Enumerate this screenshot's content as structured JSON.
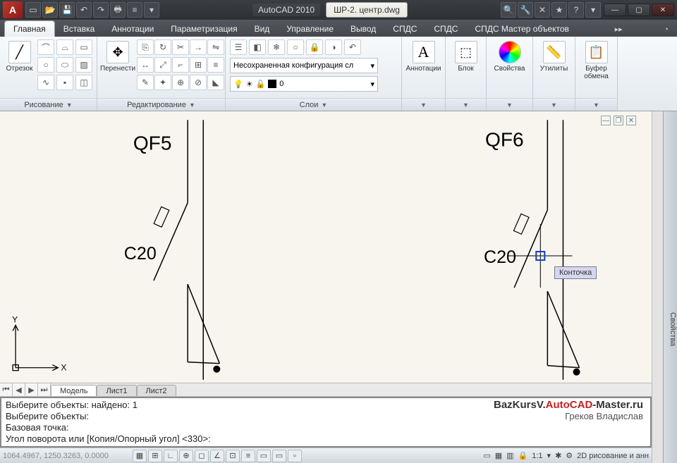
{
  "titlebar": {
    "app": "AutoCAD 2010",
    "doc": "ШР-2. центр.dwg"
  },
  "tabs": [
    "Главная",
    "Вставка",
    "Аннотации",
    "Параметризация",
    "Вид",
    "Управление",
    "Вывод",
    "СПДС",
    "СПДС",
    "СПДС Мастер объектов"
  ],
  "tabs_overflow": "▸▸",
  "panels": {
    "draw": {
      "title": "Рисование",
      "big": "Отрезок"
    },
    "edit": {
      "title": "Редактирование",
      "big": "Перенести"
    },
    "layers": {
      "title": "Слои",
      "combo": "Несохраненная конфигурация сл",
      "current": "0"
    },
    "anno": {
      "title": "",
      "big": "Аннотации"
    },
    "block": {
      "title": "",
      "big": "Блок"
    },
    "props": {
      "title": "",
      "big": "Свойства"
    },
    "util": {
      "title": "",
      "big": "Утилиты"
    },
    "clip": {
      "title": "",
      "big": "Буфер обмена"
    }
  },
  "drawing": {
    "labels": {
      "qf5": "QF5",
      "qf6": "QF6",
      "c20a": "C20",
      "c20b": "C20"
    },
    "tooltip": "Конточка",
    "axis_x": "X",
    "axis_y": "Y"
  },
  "sheets": {
    "model": "Модель",
    "s1": "Лист1",
    "s2": "Лист2"
  },
  "cmd": {
    "l1": "Выберите объекты: найдено: 1",
    "l2": "Выберите объекты:",
    "l3": "Базовая точка:",
    "l4": "Угол поворота или [Копия/Опорный угол] <330>:"
  },
  "watermark": {
    "prefix": "BazKursV.",
    "acad": "AutoCAD",
    "suffix": "-Master.ru",
    "author": "Греков Владислав"
  },
  "status": {
    "coords": "1064.4967, 1250.3263, 0.0000",
    "scale": "1:1",
    "workspace": "2D рисование и анн"
  },
  "palette": "Свойства"
}
